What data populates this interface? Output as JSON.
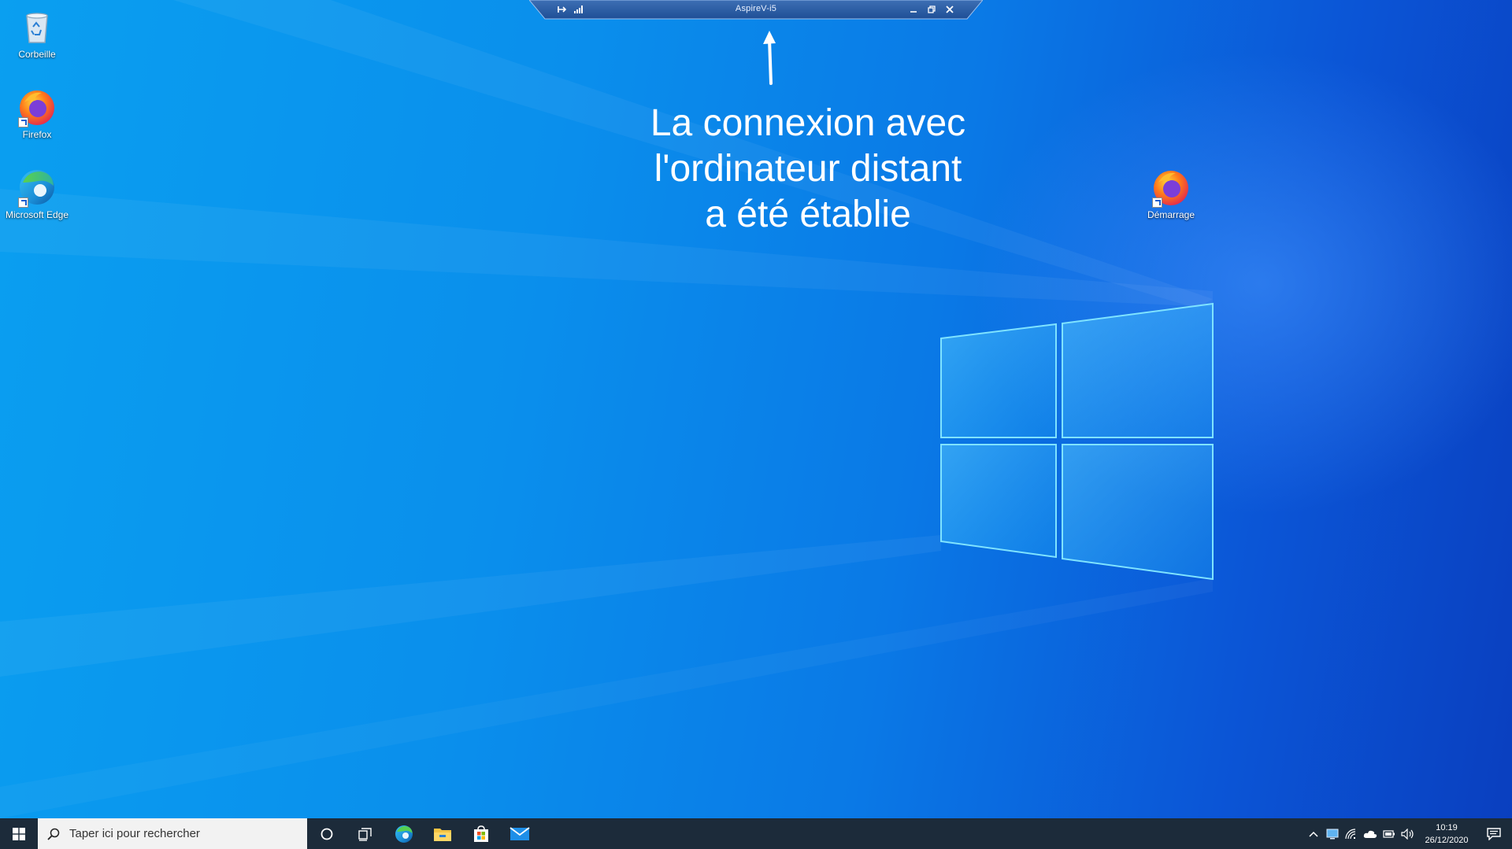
{
  "desktop": {
    "icons": [
      {
        "label": "Corbeille",
        "icon": "recycle-bin-icon"
      },
      {
        "label": "Firefox",
        "icon": "firefox-icon"
      },
      {
        "label": "Microsoft Edge",
        "icon": "edge-icon"
      },
      {
        "label": "Démarrage",
        "icon": "firefox-icon"
      }
    ]
  },
  "connection_bar": {
    "title": "AspireV-i5",
    "pin_icon": "pin-icon",
    "signal_icon": "signal-strength-icon",
    "minimize_icon": "minimize-icon",
    "restore_icon": "restore-icon",
    "close_icon": "close-icon"
  },
  "annotation": {
    "lines": [
      "La connexion avec",
      "l'ordinateur distant",
      "a été établie"
    ]
  },
  "taskbar": {
    "search_placeholder": "Taper ici pour rechercher",
    "pinned_apps": [
      "cortana-icon",
      "task-view-icon",
      "edge-icon",
      "file-explorer-icon",
      "store-icon",
      "mail-icon"
    ],
    "time": "10:19",
    "date": "26/12/2020"
  },
  "colors": {
    "accent": "#0a8fec",
    "taskbar": "#1c2b3a"
  }
}
